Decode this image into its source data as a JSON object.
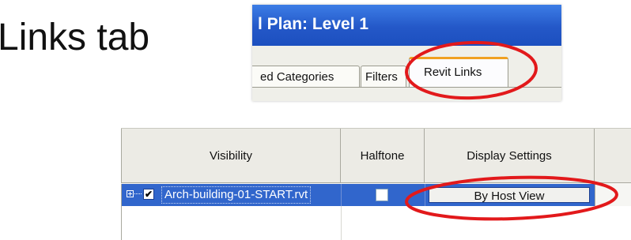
{
  "slide": {
    "heading": "Links tab"
  },
  "dialog": {
    "title": "l Plan: Level 1",
    "tabs": [
      {
        "label": "ed Categories"
      },
      {
        "label": "Filters"
      },
      {
        "label": "Revit Links",
        "active": true
      }
    ]
  },
  "table": {
    "headers": {
      "visibility": "Visibility",
      "halftone": "Halftone",
      "display_settings": "Display Settings"
    },
    "rows": [
      {
        "visible_checked": true,
        "visible_mark": "✔",
        "name": "Arch-building-01-START.rvt",
        "halftone_checked": false,
        "display_settings": "By Host View"
      }
    ]
  },
  "highlight_color": "#e2191b",
  "selection_color": "#3166cc",
  "title_bar_color": "#2458c8"
}
